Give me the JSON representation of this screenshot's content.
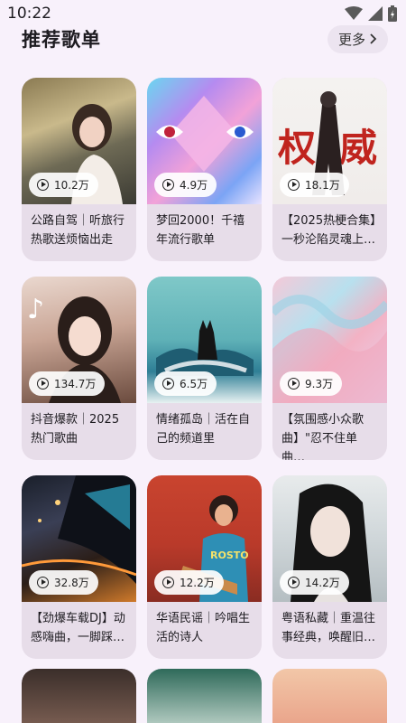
{
  "status": {
    "time": "10:22"
  },
  "section": {
    "title": "推荐歌单",
    "more_label": "更多"
  },
  "playlists": [
    {
      "plays": "10.2万",
      "title": "公路自驾｜听旅行热歌送烦恼出走",
      "bg": "linear-gradient(160deg,#8a7a52 0%,#c9b98b 35%,#6e6a55 60%,#3b3a33 100%)"
    },
    {
      "plays": "4.9万",
      "title": "梦回2000！千禧年流行歌单",
      "bg": "linear-gradient(135deg,#6ad7f0 0%,#b58bf0 30%,#f2a2d8 55%,#7ba4f5 80%,#e9e3ff 100%)"
    },
    {
      "plays": "18.1万",
      "title": "【2025热梗合集】一秒沦陷灵魂上…",
      "bg": "linear-gradient(180deg,#f4f2f0 0%,#f0ecea 100%)"
    },
    {
      "plays": "134.7万",
      "title": "抖音爆款｜2025热门歌曲",
      "bg": "linear-gradient(170deg,#ead8cf 0%,#c9a595 45%,#6b4b3e 100%)"
    },
    {
      "plays": "6.5万",
      "title": "情绪孤岛｜活在自己的频道里",
      "bg": "linear-gradient(180deg,#7fc8c8 0%,#5fb1b7 50%,#2f7f96 75%,#e8f2f2 100%)"
    },
    {
      "plays": "9.3万",
      "title": "【氛围感小众歌曲】\"忍不住单曲…",
      "bg": "linear-gradient(135deg,#f5c9d8 0%,#b8e0ee 35%,#f3b2c4 60%,#e7d6f2 100%)"
    },
    {
      "plays": "32.8万",
      "title": "【劲爆车载DJ】动感嗨曲，一脚踩…",
      "bg": "linear-gradient(160deg,#1a1f2a 0%,#3a3f55 35%,#2b1e18 65%,#d07a2b 100%)"
    },
    {
      "plays": "12.2万",
      "title": "华语民谣｜吟唱生活的诗人",
      "bg": "linear-gradient(180deg,#c9442f 0%,#b93a2a 55%,#8a2c22 100%)"
    },
    {
      "plays": "14.2万",
      "title": "粤语私藏｜重温往事经典，唤醒旧…",
      "bg": "linear-gradient(180deg,#e8ebec 0%,#cfd6d9 50%,#b5bec2 100%)"
    }
  ],
  "partial_row": [
    {
      "bg": "linear-gradient(180deg,#3a2e2a 0%,#8b6a5c 100%)"
    },
    {
      "bg": "linear-gradient(180deg,#2f6a5a 0%,#d9e7df 100%)"
    },
    {
      "bg": "linear-gradient(180deg,#f2c7a8 0%,#e79a82 100%)"
    }
  ]
}
